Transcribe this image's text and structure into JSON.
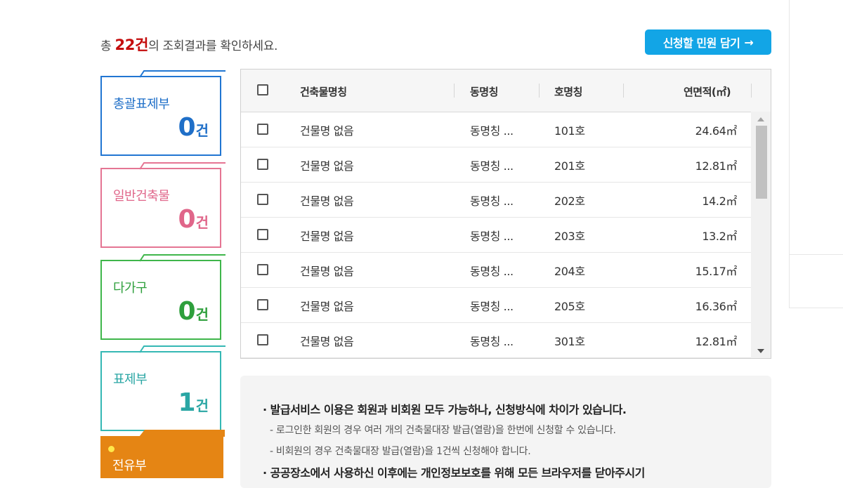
{
  "summary": {
    "prefix": "총 ",
    "count": "22건",
    "suffix": "의 조회결과를 확인하세요."
  },
  "apply_button": {
    "label": "신청할 민원 담기",
    "arrow": "→"
  },
  "categories": [
    {
      "label": "총괄표제부",
      "count": "0",
      "unit": "건",
      "color": "#1f6fc8"
    },
    {
      "label": "일반건축물",
      "count": "0",
      "unit": "건",
      "color": "#e0668a"
    },
    {
      "label": "다가구",
      "count": "0",
      "unit": "건",
      "color": "#2e9f3c"
    },
    {
      "label": "표제부",
      "count": "1",
      "unit": "건",
      "color": "#2aa6a4"
    },
    {
      "label": "전유부",
      "color": "#e58514"
    }
  ],
  "table": {
    "headers": {
      "building_name": "건축물명칭",
      "dong": "동명칭",
      "ho": "호명칭",
      "area": "연면적(㎡)"
    },
    "rows": [
      {
        "building_name": "건물명 없음",
        "dong": "동명칭 ...",
        "ho": "101호",
        "area": "24.64㎡"
      },
      {
        "building_name": "건물명 없음",
        "dong": "동명칭 ...",
        "ho": "201호",
        "area": "12.81㎡"
      },
      {
        "building_name": "건물명 없음",
        "dong": "동명칭 ...",
        "ho": "202호",
        "area": "14.2㎡"
      },
      {
        "building_name": "건물명 없음",
        "dong": "동명칭 ...",
        "ho": "203호",
        "area": "13.2㎡"
      },
      {
        "building_name": "건물명 없음",
        "dong": "동명칭 ...",
        "ho": "204호",
        "area": "15.17㎡"
      },
      {
        "building_name": "건물명 없음",
        "dong": "동명칭 ...",
        "ho": "205호",
        "area": "16.36㎡"
      },
      {
        "building_name": "건물명 없음",
        "dong": "동명칭 ...",
        "ho": "301호",
        "area": "12.81㎡"
      }
    ]
  },
  "notice": {
    "main1": "· 발급서비스 이용은 회원과 비회원 모두 가능하나, 신청방식에 차이가 있습니다.",
    "sub1": "- 로그인한 회원의 경우 여러 개의 건축물대장 발급(열람)을 한번에 신청할 수 있습니다.",
    "sub2": "- 비회원의 경우 건축물대장 발급(열람)을 1건씩 신청해야 합니다.",
    "main2": "· 공공장소에서 사용하신 이후에는 개인정보보호를 위해 모든 브라우저를 닫아주시기"
  },
  "colors": {
    "accent": "#12a5e6",
    "count_red": "#c40d0d"
  }
}
